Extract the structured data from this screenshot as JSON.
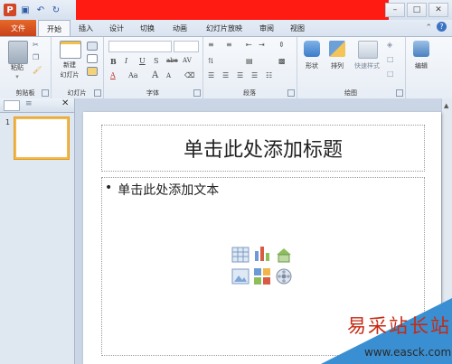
{
  "title_bar": {
    "app_icon": "powerpoint-icon",
    "qat": [
      "save-icon",
      "undo-icon",
      "redo-icon"
    ],
    "controls": [
      "minimize",
      "maximize",
      "close"
    ]
  },
  "tabs": [
    {
      "label": "文件",
      "active": false
    },
    {
      "label": "开始",
      "active": true
    },
    {
      "label": "插入",
      "active": false
    },
    {
      "label": "设计",
      "active": false
    },
    {
      "label": "切换",
      "active": false
    },
    {
      "label": "动画",
      "active": false
    },
    {
      "label": "幻灯片放映",
      "active": false
    },
    {
      "label": "审阅",
      "active": false
    },
    {
      "label": "视图",
      "active": false
    }
  ],
  "ribbon": {
    "clipboard": {
      "paste": "粘贴",
      "group": "剪贴板"
    },
    "slides": {
      "new_slide": "新建",
      "new_slide2": "幻灯片",
      "group": "幻灯片"
    },
    "font": {
      "group": "字体",
      "bold": "B",
      "italic": "I",
      "underline": "U",
      "strike": "S",
      "shadow": "abe",
      "spacing": "AV",
      "font_color": "A",
      "case": "Aa",
      "grow": "A",
      "shrink": "A"
    },
    "paragraph": {
      "group": "段落"
    },
    "drawing": {
      "shape": "形状",
      "arrange": "排列",
      "quick_styles": "快速样式",
      "group": "绘图"
    },
    "editing": {
      "edit": "编辑"
    }
  },
  "thumbnail": {
    "number": "1"
  },
  "slide": {
    "title_placeholder": "单击此处添加标题",
    "bullet": "•",
    "content_placeholder": "单击此处添加文本"
  },
  "watermark": {
    "name": "易采站长站",
    "url": "www.easck.com"
  },
  "colors": {
    "file_tab": "#d85a22",
    "redaction": "#ff1a12",
    "thumb_border": "#f2b84a",
    "watermark_red": "#c62a12",
    "watermark_blue": "#3a8fd2"
  }
}
